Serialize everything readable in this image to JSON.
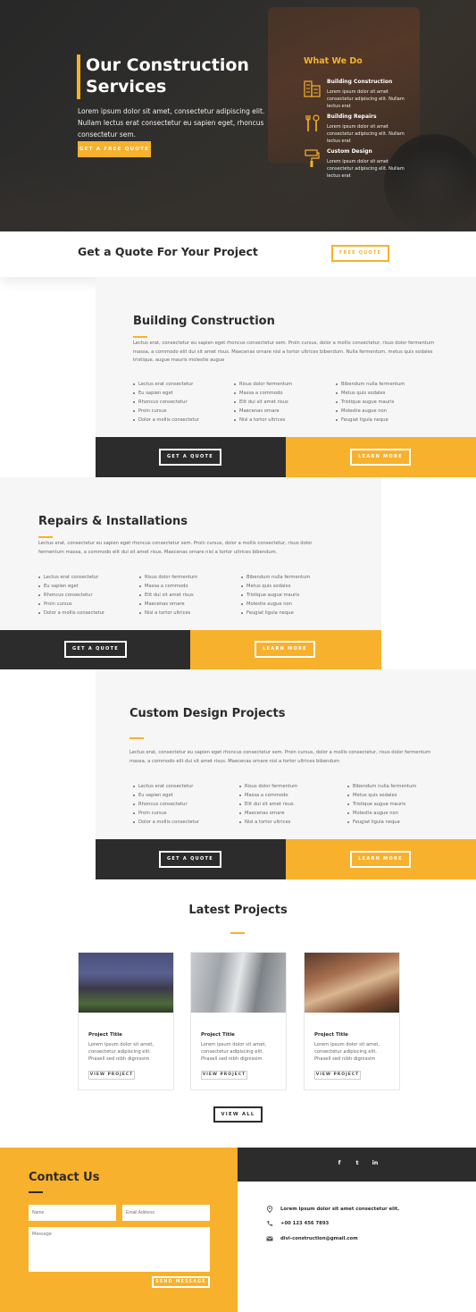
{
  "hero": {
    "title_line1": "Our Construction",
    "title_line2": "Services",
    "text": "Lorem ipsum dolor sit amet, consectetur adipiscing elit. Nullam lectus erat consectetur eu sapien eget, rhoncus consectetur sem.",
    "button": "GET A FREE QUOTE"
  },
  "what_we_do": {
    "title": "What We Do",
    "items": [
      {
        "icon": "building-icon",
        "title": "Building Construction",
        "desc": "Lorem ipsum dolor sit amet consectetur adipiscing elit. Nullam lectus erat"
      },
      {
        "icon": "tools-icon",
        "title": "Building Repairs",
        "desc": "Lorem ipsum dolor sit amet consectetur adipiscing elit. Nullam lectus erat"
      },
      {
        "icon": "paint-roller-icon",
        "title": "Custom Design",
        "desc": "Lorem ipsum dolor sit amet consectetur adipiscing elit. Nullam lectus erat"
      }
    ]
  },
  "quote_bar": {
    "title": "Get a Quote For Your Project",
    "button": "FREE QUOTE"
  },
  "services": [
    {
      "title": "Building Construction",
      "text": "Lectus erat, consectetur eu sapien eget rhoncus consectetur sem. Proin cursus, dolor a mollis consectetur, risus dolor fermentum massa, a commodo elit dui sit amet risus. Maecenas ornare nisl a tortor ultrices bibendum. Nulla fermentum, metus quis sodales tristique, augue mauris molestie augue",
      "col1": [
        "Lectus erat consectetur",
        "Eu sapien eget",
        "Rhoncus consectetur",
        "Proin cursus",
        "Dolor a mollis consectetur"
      ],
      "col2": [
        "Risus dolor fermentum",
        "Massa a commodo",
        "Elit dui sit amet risus",
        "Maecenas ornare",
        "Nisl a tortor ultrices"
      ],
      "col3": [
        "Bibendum nulla fermentum",
        "Metus quis sodales",
        "Tristique augue mauris",
        "Molestie augue non",
        "Feugiat ligula neque"
      ],
      "btn_quote": "GET A QUOTE",
      "btn_more": "LEARN MORE"
    },
    {
      "title": "Repairs & Installations",
      "text": "Lectus erat, consectetur eu sapien eget rhoncus consectetur sem. Proin cursus, dolor a mollis consectetur, risus dolor fermentum massa, a commodo elit dui sit amet risus. Maecenas ornare nisl a tortor ultrices bibendum.",
      "col1": [
        "Lectus erat consectetur",
        "Eu sapien eget",
        "Rhoncus consectetur",
        "Proin cursus",
        "Dolor a mollis consectetur"
      ],
      "col2": [
        "Risus dolor fermentum",
        "Massa a commodo",
        "Elit dui sit amet risus",
        "Maecenas ornare",
        "Nisl a tortor ultrices"
      ],
      "col3": [
        "Bibendum nulla fermentum",
        "Metus quis sodales",
        "Tristique augue mauris",
        "Molestie augue non",
        "Feugiat ligula neque"
      ],
      "btn_quote": "GET A QUOTE",
      "btn_more": "LEARN MORE"
    },
    {
      "title": "Custom Design Projects",
      "text": "Lectus erat, consectetur eu sapien eget rhoncus consectetur sem. Proin cursus, dolor a mollis consectetur, risus dolor fermentum massa, a commodo elit dui sit amet risus. Maecenas ornare nisl a tortor ultrices bibendum",
      "col1": [
        "Lectus erat consectetur",
        "Eu sapien eget",
        "Rhoncus consectetur",
        "Proin cursus",
        "Dolor a mollis consectetur"
      ],
      "col2": [
        "Risus dolor fermentum",
        "Massa a commodo",
        "Elit dui sit amet risus",
        "Maecenas ornare",
        "Nisl a tortor ultrices"
      ],
      "col3": [
        "Bibendum nulla fermentum",
        "Metus quis sodales",
        "Tristique augue mauris",
        "Molestie augue non",
        "Feugiat ligula neque"
      ],
      "btn_quote": "GET A QUOTE",
      "btn_more": "LEARN MORE"
    }
  ],
  "latest": {
    "title": "Latest Projects",
    "cards": [
      {
        "title": "Project Title",
        "desc": "Lorem ipsum dolor sit amet, consectetur adipiscing elit. Phasell sed nibh dignissim",
        "button": "VIEW PROJECT"
      },
      {
        "title": "Project Title",
        "desc": "Lorem ipsum dolor sit amet, consectetur adipiscing elit. Phasell sed nibh dignissim",
        "button": "VIEW PROJECT"
      },
      {
        "title": "Project Title",
        "desc": "Lorem ipsum dolor sit amet, consectetur adipiscing elit. Phasell sed nibh dignissim",
        "button": "VIEW PROJECT"
      }
    ],
    "view_all": "VIEW ALL"
  },
  "contact": {
    "title": "Contact Us",
    "name_placeholder": "Name",
    "email_placeholder": "Email Address",
    "message_placeholder": "Message",
    "send": "SEND MESSAGE",
    "social": [
      "f",
      "t",
      "in"
    ],
    "address": "Lorem ipsum dolor sit amet consectetur elit.",
    "phone": "+00 123 456 7893",
    "email": "divi-construction@gmail.com"
  },
  "colors": {
    "accent": "#f8b12c",
    "dark": "#2c2c2c",
    "light_bg": "#f6f6f6"
  }
}
